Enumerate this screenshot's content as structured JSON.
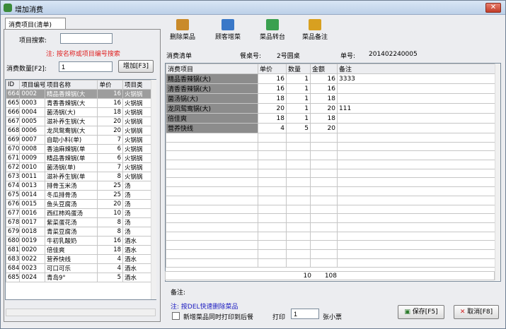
{
  "window": {
    "title": "增加消费",
    "close": "✕"
  },
  "left": {
    "tab": "消费项目(清单)",
    "search_label": "项目搜索:",
    "search_value": "",
    "hint": "注: 按名称或项目编号搜索",
    "qty_label": "消费数量[F2]:",
    "qty_value": "1",
    "add_button": "增加[F3]",
    "columns": [
      "ID",
      "项目编号",
      "项目名称",
      "单价",
      "项目类"
    ],
    "rows": [
      [
        "664",
        "0002",
        "精品香辣锅(大",
        "16",
        "火锅锅"
      ],
      [
        "665",
        "0003",
        "青香香辣锅(大",
        "16",
        "火锅锅"
      ],
      [
        "666",
        "0004",
        "菌汤锅(大)",
        "18",
        "火锅锅"
      ],
      [
        "667",
        "0005",
        "滋补养生锅(大",
        "20",
        "火锅锅"
      ],
      [
        "668",
        "0006",
        "龙凤鸳鸯锅(大",
        "20",
        "火锅锅"
      ],
      [
        "669",
        "0007",
        "自助小料(单)",
        "7",
        "火锅锅"
      ],
      [
        "670",
        "0008",
        "香油麻辣锅(单",
        "6",
        "火锅锅"
      ],
      [
        "671",
        "0009",
        "精品香辣锅(单",
        "6",
        "火锅锅"
      ],
      [
        "672",
        "0010",
        "菌汤锅(单)",
        "7",
        "火锅锅"
      ],
      [
        "673",
        "0011",
        "滋补养生锅(单",
        "8",
        "火锅锅"
      ],
      [
        "674",
        "0013",
        "排骨玉米汤",
        "25",
        "汤"
      ],
      [
        "675",
        "0014",
        "冬瓜排骨汤",
        "25",
        "汤"
      ],
      [
        "676",
        "0015",
        "鱼头豆腐汤",
        "20",
        "汤"
      ],
      [
        "677",
        "0016",
        "西红柿鸡蛋汤",
        "10",
        "汤"
      ],
      [
        "678",
        "0017",
        "紫菜蛋花汤",
        "8",
        "汤"
      ],
      [
        "679",
        "0018",
        "青菜豆腐汤",
        "8",
        "汤"
      ],
      [
        "680",
        "0019",
        "牛初乳酸奶",
        "16",
        "酒水"
      ],
      [
        "681",
        "0020",
        "倍佳爽",
        "18",
        "酒水"
      ],
      [
        "683",
        "0022",
        "营养快线",
        "4",
        "酒水"
      ],
      [
        "684",
        "0023",
        "可口可乐",
        "4",
        "酒水"
      ],
      [
        "685",
        "0024",
        "青岛9°",
        "5",
        "酒水"
      ]
    ]
  },
  "toolbar": [
    {
      "label": "删除菜品",
      "icon": "delete-dish-icon",
      "color": "#c98a2a"
    },
    {
      "label": "顾客增菜",
      "icon": "customer-add-icon",
      "color": "#3a78c8"
    },
    {
      "label": "菜品转台",
      "icon": "transfer-table-icon",
      "color": "#3aa050"
    },
    {
      "label": "菜品备注",
      "icon": "dish-note-icon",
      "color": "#d8a020"
    }
  ],
  "info": {
    "list_label": "消费清单",
    "table_label": "餐桌号:",
    "table_value": "2号圆桌",
    "order_label": "单号:",
    "order_value": "201402240005"
  },
  "consumption": {
    "columns": [
      "消费项目",
      "单价",
      "数量",
      "金额",
      "备注"
    ],
    "rows": [
      [
        "精品香辣锅(大)",
        "16",
        "1",
        "16",
        "3333"
      ],
      [
        "清香香辣锅(大)",
        "16",
        "1",
        "16",
        ""
      ],
      [
        "菌汤锅(大)",
        "18",
        "1",
        "18",
        ""
      ],
      [
        "龙凤鸳鸯锅(大)",
        "20",
        "1",
        "20",
        "111"
      ],
      [
        "倍佳爽",
        "18",
        "1",
        "18",
        ""
      ],
      [
        "营养快线",
        "4",
        "5",
        "20",
        ""
      ]
    ],
    "totals": {
      "qty": "10",
      "amount": "108"
    }
  },
  "notes": {
    "label": "备注:",
    "hint": "注: 按DEL快速删除菜品",
    "print_checkbox_label": "新增菜品同时打印到后餐",
    "print_label": "打印",
    "print_value": "1",
    "copies_label": "张小票"
  },
  "actions": {
    "save": "保存[F5]",
    "cancel": "取消[F8]"
  }
}
